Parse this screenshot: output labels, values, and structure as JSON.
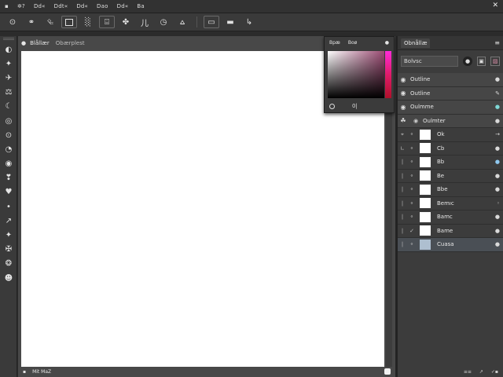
{
  "menubar": {
    "items": [
      "▪",
      "✲?",
      "Dd«",
      "Ddt«",
      "Dd«",
      "Dao",
      "Dd«",
      "Ba"
    ],
    "close": "✕"
  },
  "optbar": {
    "buttons": [
      "⊙",
      "⚭",
      "⮴",
      "□",
      "░",
      "⌹",
      "✤",
      "⼉",
      "◷",
      "⩟",
      "▭",
      "▬",
      "↳"
    ]
  },
  "toolbar": {
    "tools": [
      "◐",
      "✦",
      "✈",
      "⚖",
      "☾",
      "◎",
      "⊙",
      "◔",
      "◉",
      "❣",
      "♥",
      "•",
      "↗",
      "✦",
      "✠",
      "❂",
      "☻"
    ]
  },
  "document": {
    "tab_title": "Blållær",
    "tab_subtitle": "Obærplest",
    "tab_close": "●",
    "status_zoom": "▪",
    "status_info": "Mit MaZ"
  },
  "color_picker": {
    "label_a": "Bpæ",
    "label_b": "Boø",
    "footer_value": "0|",
    "dot": "●"
  },
  "panel": {
    "tab": "Obnållæ",
    "menu": "≡",
    "search_value": "Bolvsc",
    "search_buttons": [
      "●",
      "▣",
      "▨"
    ],
    "rows": [
      {
        "name": "Outline",
        "end": "●",
        "kind": "grp",
        "indent": false
      },
      {
        "name": "Outline",
        "end": "✎",
        "kind": "grp",
        "indent": false
      },
      {
        "name": "Oulmme",
        "end": "●",
        "kind": "grp",
        "indent": false
      },
      {
        "name": "Oulmter",
        "end": "●",
        "kind": "grp",
        "indent": true
      },
      {
        "name": "Ok",
        "end": "→",
        "kind": "layer"
      },
      {
        "name": "Cb",
        "end": "●",
        "kind": "layer"
      },
      {
        "name": "Bb",
        "end": "●",
        "kind": "layer"
      },
      {
        "name": "Be",
        "end": "●",
        "kind": "layer"
      },
      {
        "name": "Bbe",
        "end": "●",
        "kind": "layer"
      },
      {
        "name": "Bemıc",
        "end": "◦",
        "kind": "layer"
      },
      {
        "name": "Bamc",
        "end": "●",
        "kind": "layer"
      },
      {
        "name": "Bame",
        "end": "●",
        "kind": "layer"
      },
      {
        "name": "Cuasa",
        "end": "●",
        "kind": "active"
      }
    ],
    "bottom": [
      "≡≡",
      "↗",
      "✓▪"
    ]
  },
  "colors": {
    "canvas": "#ffffff",
    "active_row": "#4a4f55",
    "accent_pink": "#ff2bd8"
  }
}
